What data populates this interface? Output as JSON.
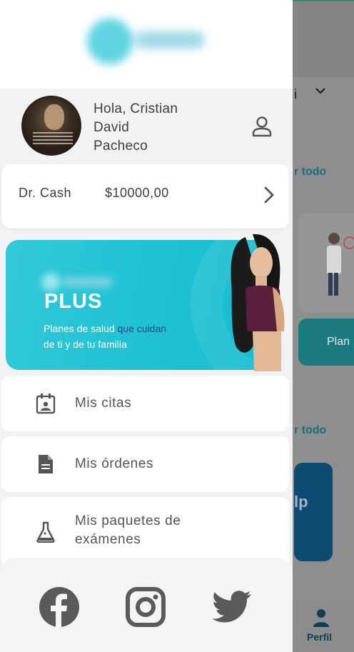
{
  "background": {
    "select_text": "i",
    "ver_todo_1": "r todo",
    "ver_todo_2": "r todo",
    "plan_button": "Plan",
    "logo_text": "lp",
    "tab_profile_label": "Perfil"
  },
  "drawer": {
    "user": {
      "greeting_line1": "Hola, Cristian",
      "greeting_line2": "David",
      "greeting_line3": "Pacheco",
      "icon": "user-icon"
    },
    "cash": {
      "label": "Dr. Cash",
      "amount": "$10000,00"
    },
    "plus_banner": {
      "title": "PLUS",
      "line1_prefix": "Planes de salud ",
      "line1_highlight": "que cuidan",
      "line2": "de ti y de tu familia"
    },
    "menu": [
      {
        "label": "Mis citas",
        "icon": "calendar-icon"
      },
      {
        "label": "Mis órdenes",
        "icon": "document-icon"
      },
      {
        "label_line1": "Mis paquetes de",
        "label_line2": "exámenes",
        "icon": "flask-icon"
      }
    ],
    "social": [
      {
        "name": "Facebook",
        "icon": "facebook-icon"
      },
      {
        "name": "Instagram",
        "icon": "instagram-icon"
      },
      {
        "name": "Twitter",
        "icon": "twitter-icon"
      }
    ]
  },
  "colors": {
    "accent": "#21c3d4",
    "highlight_text": "#1a4b8c",
    "icon_gray": "#555555",
    "background_dim": "#8a8a8a"
  }
}
